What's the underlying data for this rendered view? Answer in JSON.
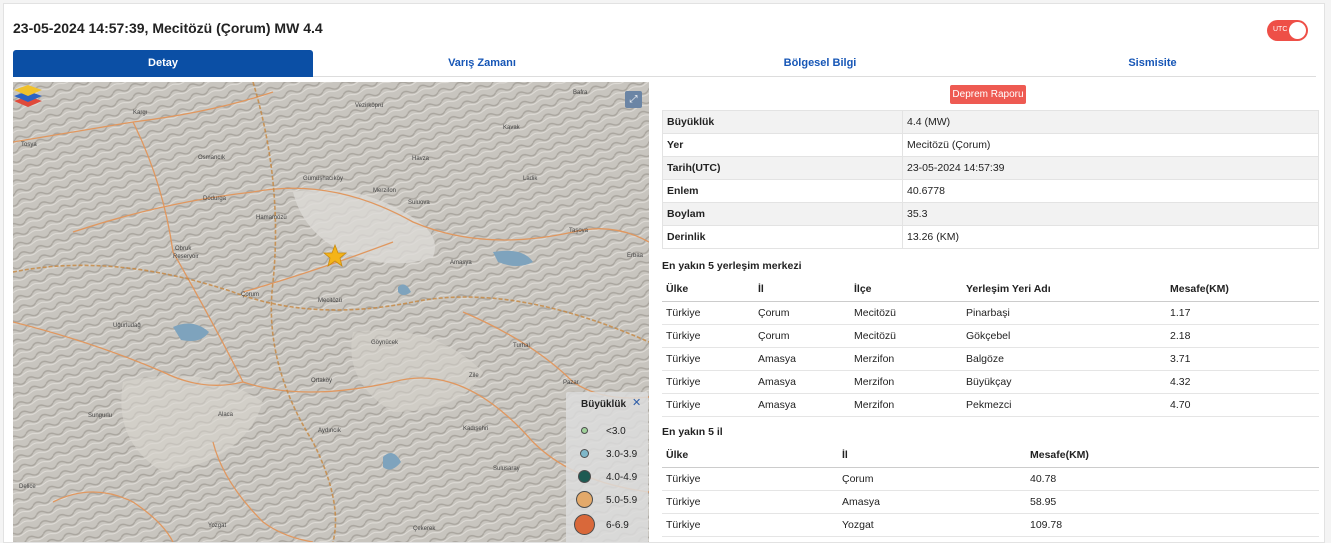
{
  "header": {
    "title": "23-05-2024 14:57:39, Mecitözü (Çorum) MW 4.4",
    "utc_toggle_label": "UTC",
    "utc_toggle_on": true
  },
  "tabs": [
    {
      "label": "Detay",
      "active": true
    },
    {
      "label": "Varış Zamanı",
      "active": false
    },
    {
      "label": "Bölgesel Bilgi",
      "active": false
    },
    {
      "label": "Sismisite",
      "active": false
    }
  ],
  "map": {
    "fullscreen_icon": "expand-icon",
    "layers_icon": "layers-icon",
    "epicenter_icon": "star-icon",
    "places": [
      "Vezirköprü",
      "Kargı",
      "Bafra",
      "Osmancık",
      "Havza",
      "Kavak",
      "Tosya",
      "Gümüşhacıköy",
      "Merzifon",
      "Suluova",
      "Dodurga",
      "Hamamözü",
      "Ladik",
      "Taşova",
      "Obruk Reservoir",
      "Erbaa",
      "Çorum",
      "Amasya",
      "Uğurludağ",
      "Mecitözü",
      "Göynücek",
      "Turhal",
      "Ortaköy",
      "Zile",
      "Pazar",
      "Sungurlu",
      "Alaca",
      "Aydıncık",
      "Kadışehri",
      "Sulusaray",
      "Yozgat",
      "Çekerek",
      "Delice"
    ],
    "legend": {
      "title": "Büyüklük",
      "close_icon": "close-icon",
      "items": [
        {
          "label": "<3.0",
          "color": "#9fd19a"
        },
        {
          "label": "3.0-3.9",
          "color": "#7fb7c9"
        },
        {
          "label": "4.0-4.9",
          "color": "#1d5a52"
        },
        {
          "label": "5.0-5.9",
          "color": "#e3a96a"
        },
        {
          "label": "6-6.9",
          "color": "#d9683a"
        }
      ]
    }
  },
  "report_button": "Deprem Raporu",
  "details": [
    {
      "key": "Büyüklük",
      "value": "4.4 (MW)"
    },
    {
      "key": "Yer",
      "value": "Mecitözü (Çorum)"
    },
    {
      "key": "Tarih(UTC)",
      "value": "23-05-2024 14:57:39"
    },
    {
      "key": "Enlem",
      "value": "40.6778"
    },
    {
      "key": "Boylam",
      "value": "35.3"
    },
    {
      "key": "Derinlik",
      "value": "13.26 (KM)"
    }
  ],
  "settlements": {
    "title": "En yakın 5 yerleşim merkezi",
    "headers": [
      "Ülke",
      "İl",
      "İlçe",
      "Yerleşim Yeri Adı",
      "Mesafe(KM)"
    ],
    "rows": [
      [
        "Türkiye",
        "Çorum",
        "Mecitözü",
        "Pinarbaşi",
        "1.17"
      ],
      [
        "Türkiye",
        "Çorum",
        "Mecitözü",
        "Gökçebel",
        "2.18"
      ],
      [
        "Türkiye",
        "Amasya",
        "Merzifon",
        "Balgöze",
        "3.71"
      ],
      [
        "Türkiye",
        "Amasya",
        "Merzifon",
        "Büyükçay",
        "4.32"
      ],
      [
        "Türkiye",
        "Amasya",
        "Merzifon",
        "Pekmezci",
        "4.70"
      ]
    ]
  },
  "provinces": {
    "title": "En yakın 5 il",
    "headers": [
      "Ülke",
      "İl",
      "Mesafe(KM)"
    ],
    "rows": [
      [
        "Türkiye",
        "Çorum",
        "40.78"
      ],
      [
        "Türkiye",
        "Amasya",
        "58.95"
      ],
      [
        "Türkiye",
        "Yozgat",
        "109.78"
      ]
    ]
  },
  "colors": {
    "tab_active": "#0b4fa5",
    "tab_text": "#1656b6",
    "accent_red": "#ee4f47",
    "report_button": "#ee5a52"
  }
}
